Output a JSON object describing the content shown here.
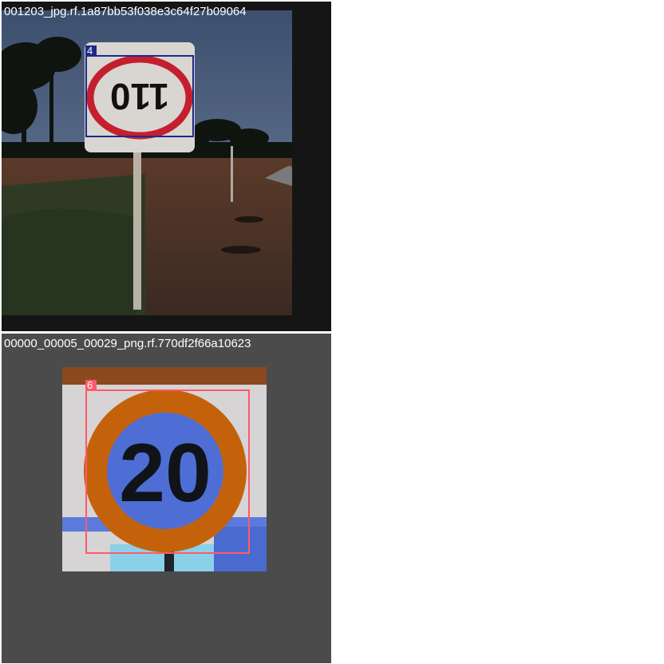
{
  "tiles": [
    {
      "filename": "001203_jpg.rf.1a87bb53f038e3c64f27b09064",
      "label": "4",
      "box_color": "#1c2a8a",
      "sign_text": "110"
    },
    {
      "filename": "00000_00005_00029_png.rf.770df2f66a10623",
      "label": "6",
      "box_color": "#ff5a6a",
      "sign_text": "20"
    }
  ]
}
